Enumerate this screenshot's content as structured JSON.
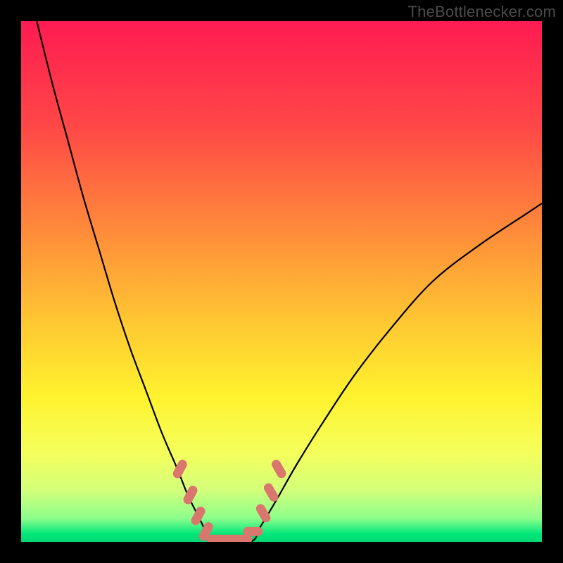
{
  "watermark": "TheBottlenecker.com",
  "chart_data": {
    "type": "line",
    "title": "",
    "xlabel": "",
    "ylabel": "",
    "xlim": [
      0,
      100
    ],
    "ylim": [
      0,
      100
    ],
    "grid": false,
    "legend": false,
    "notes": "No axes, tick labels, or data labels are rendered. The plot shows two concave black curves descending from the top edges into a flat bottom valley, with a salmon/pink stepped marker segment at the valley. Background is a smooth vertical gradient red→orange→yellow→green with a thin bright green band at the very bottom. Values below are visual estimates on a 0–100 axis.",
    "background_gradient_stops": [
      {
        "pos": 0.0,
        "color": "#ff1b52"
      },
      {
        "pos": 0.2,
        "color": "#ff4747"
      },
      {
        "pos": 0.4,
        "color": "#ff8a3a"
      },
      {
        "pos": 0.58,
        "color": "#ffc832"
      },
      {
        "pos": 0.72,
        "color": "#fff22e"
      },
      {
        "pos": 0.83,
        "color": "#f4ff5c"
      },
      {
        "pos": 0.9,
        "color": "#d4ff7a"
      },
      {
        "pos": 0.955,
        "color": "#8cff8c"
      },
      {
        "pos": 0.985,
        "color": "#00e67a"
      },
      {
        "pos": 1.0,
        "color": "#00d873"
      }
    ],
    "series": [
      {
        "name": "left-curve",
        "x": [
          3,
          6,
          9,
          12,
          15,
          18,
          21,
          24,
          27,
          30,
          32,
          34,
          35.5,
          37
        ],
        "y": [
          100,
          88,
          77,
          66,
          56,
          46,
          37,
          29,
          21,
          14,
          9,
          5,
          2,
          0
        ]
      },
      {
        "name": "valley-flat",
        "x": [
          37,
          44
        ],
        "y": [
          0,
          0
        ]
      },
      {
        "name": "right-curve",
        "x": [
          44,
          46,
          49,
          53,
          58,
          64,
          71,
          79,
          88,
          97,
          100
        ],
        "y": [
          0,
          3,
          8,
          15,
          23,
          32,
          41,
          50,
          57,
          63,
          65
        ]
      },
      {
        "name": "valley-markers",
        "style": "salmon-capsules",
        "color": "#d9776e",
        "x": [
          30.5,
          32.5,
          34.0,
          35.5,
          37.5,
          40.0,
          42.5,
          44.5,
          46.5,
          48.0,
          49.5
        ],
        "y": [
          14.0,
          9.0,
          5.0,
          2.0,
          0.5,
          0.5,
          0.5,
          2.0,
          5.5,
          9.5,
          14.0
        ]
      }
    ]
  }
}
